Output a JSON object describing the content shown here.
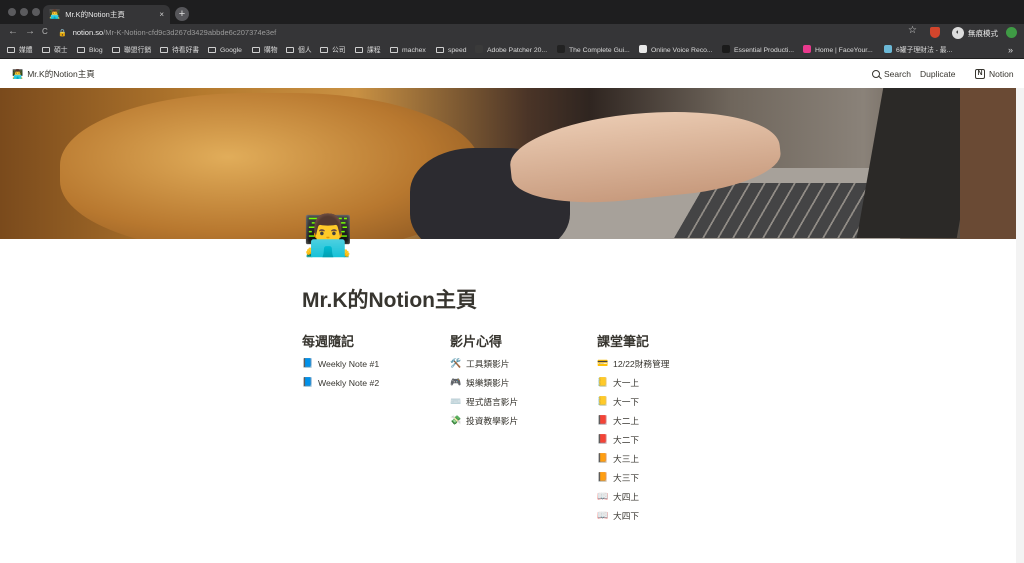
{
  "browser": {
    "tab": {
      "title": "Mr.K的Notion主頁",
      "favicon": "👨‍💻",
      "close": "×"
    },
    "new_tab": "+",
    "nav": {
      "back": "←",
      "forward": "→",
      "reload": "C"
    },
    "url": {
      "host": "notion.so",
      "path": "/Mr-K-Notion-cfd9c3d267d3429abbde6c207374e3ef"
    },
    "star": "☆",
    "incognito_label": "無痕模式",
    "more_bookmarks": "»",
    "bookmarks": [
      {
        "label": "媒體",
        "kind": "folder"
      },
      {
        "label": "碩士",
        "kind": "folder"
      },
      {
        "label": "Blog",
        "kind": "folder"
      },
      {
        "label": "聯盟行銷",
        "kind": "folder"
      },
      {
        "label": "待看好書",
        "kind": "folder"
      },
      {
        "label": "Google",
        "kind": "folder"
      },
      {
        "label": "購物",
        "kind": "folder"
      },
      {
        "label": "個人",
        "kind": "folder"
      },
      {
        "label": "公司",
        "kind": "folder"
      },
      {
        "label": "課程",
        "kind": "folder"
      },
      {
        "label": "machex",
        "kind": "folder"
      },
      {
        "label": "speed",
        "kind": "folder"
      },
      {
        "label": "Adobe Patcher 20...",
        "kind": "site",
        "color": "#3a3a3a"
      },
      {
        "label": "The Complete Gui...",
        "kind": "site",
        "color": "#222222"
      },
      {
        "label": "Online Voice Reco...",
        "kind": "site",
        "color": "#e8e8e8"
      },
      {
        "label": "Essential Producti...",
        "kind": "site",
        "color": "#1b1b1b"
      },
      {
        "label": "Home | FaceYour...",
        "kind": "site",
        "color": "#e8398d"
      },
      {
        "label": "6罐子理財法 - 最...",
        "kind": "site",
        "color": "#6bb8d6"
      }
    ]
  },
  "topbar": {
    "breadcrumb": {
      "icon": "👨‍💻",
      "label": "Mr.K的Notion主頁"
    },
    "search_label": "Search",
    "duplicate_label": "Duplicate",
    "notion_label": "Notion",
    "notion_glyph": "N"
  },
  "page": {
    "icon": "👨‍💻",
    "title": "Mr.K的Notion主頁",
    "columns": [
      {
        "heading": "每週隨記",
        "items": [
          {
            "icon": "📘",
            "label": "Weekly Note #1"
          },
          {
            "icon": "📘",
            "label": "Weekly Note #2"
          }
        ]
      },
      {
        "heading": "影片心得",
        "items": [
          {
            "icon": "🛠️",
            "label": "工具類影片"
          },
          {
            "icon": "🎮",
            "label": "娛樂類影片"
          },
          {
            "icon": "⌨️",
            "label": "程式語言影片"
          },
          {
            "icon": "💸",
            "label": "投資教學影片"
          }
        ]
      },
      {
        "heading": "課堂筆記",
        "items": [
          {
            "icon": "💳",
            "label": "12/22財務管理"
          },
          {
            "icon": "📒",
            "label": "大一上"
          },
          {
            "icon": "📒",
            "label": "大一下"
          },
          {
            "icon": "📕",
            "label": "大二上"
          },
          {
            "icon": "📕",
            "label": "大二下"
          },
          {
            "icon": "📙",
            "label": "大三上"
          },
          {
            "icon": "📙",
            "label": "大三下"
          },
          {
            "icon": "📖",
            "label": "大四上"
          },
          {
            "icon": "📖",
            "label": "大四下"
          }
        ]
      }
    ]
  }
}
